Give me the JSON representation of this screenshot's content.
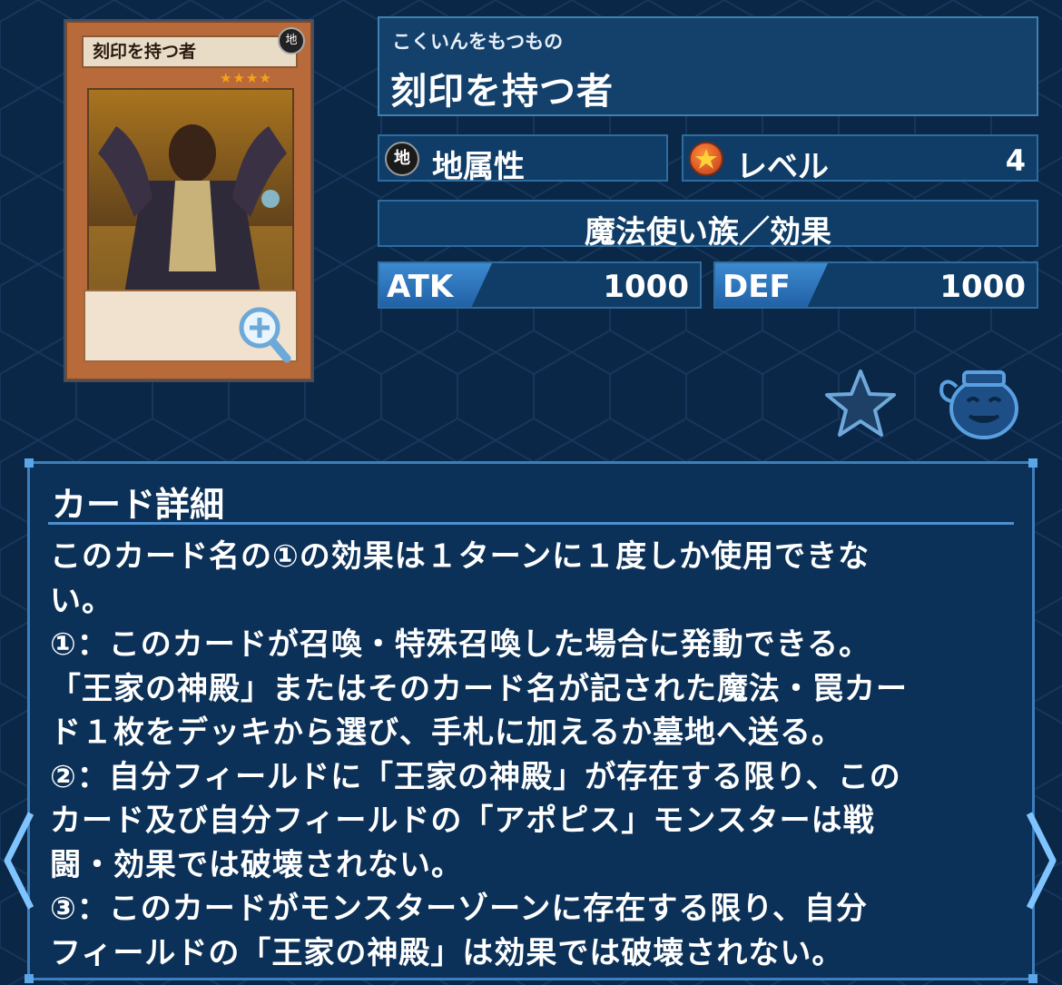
{
  "card": {
    "art_name": "刻印を持つ者",
    "art_attribute_glyph": "地",
    "art_level_stars": "★★★★"
  },
  "name": {
    "ruby": "こくいんをもつもの",
    "title": "刻印を持つ者"
  },
  "attribute": {
    "icon": "earth-attribute-icon",
    "glyph": "地",
    "label": "地属性"
  },
  "level": {
    "icon": "level-star-icon",
    "label": "レベル",
    "value": "4"
  },
  "race": {
    "label": "魔法使い族／効果"
  },
  "stats": {
    "atk_label": "ATK",
    "atk_value": "1000",
    "def_label": "DEF",
    "def_value": "1000"
  },
  "actions": {
    "favorite_icon": "star-icon",
    "deck_icon": "pot-of-greed-icon"
  },
  "detail": {
    "title": "カード詳細",
    "lines": [
      "このカード名の①の効果は１ターンに１度しか使用できな",
      "い。",
      "①：このカードが召喚・特殊召喚した場合に発動できる。",
      "「王家の神殿」またはそのカード名が記された魔法・罠カー",
      "ド１枚をデッキから選び、手札に加えるか墓地へ送る。",
      "②：自分フィールドに「王家の神殿」が存在する限り、この",
      "カード及び自分フィールドの「アポピス」モンスターは戦",
      "闘・効果では破壊されない。",
      "③：このカードがモンスターゾーンに存在する限り、自分",
      "フィールドの「王家の神殿」は効果では破壊されない。"
    ]
  },
  "colors": {
    "background": "#0b2747",
    "panel": "#0c3158",
    "accent": "#3c7fbd",
    "stat_tab": "#2f78c0"
  }
}
